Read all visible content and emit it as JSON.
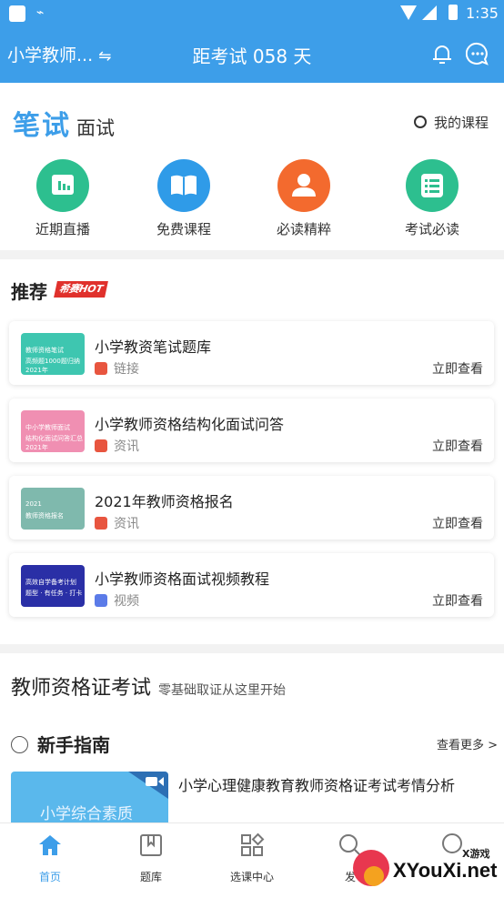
{
  "status_bar": {
    "time": "1:35"
  },
  "header": {
    "exam_name": "小学教师...",
    "countdown": "距考试 058 天"
  },
  "tabs": {
    "active": "笔试",
    "inactive": "面试"
  },
  "my_course": "我的课程",
  "quick_entries": [
    {
      "label": "近期直播",
      "color": "#2dbf8f",
      "icon": "live-stream-icon"
    },
    {
      "label": "免费课程",
      "color": "#2f9be8",
      "icon": "book-icon"
    },
    {
      "label": "必读精粹",
      "color": "#f36a2e",
      "icon": "person-icon"
    },
    {
      "label": "考试必读",
      "color": "#2dbf8f",
      "icon": "list-icon"
    }
  ],
  "recommend": {
    "title": "推荐",
    "hot_badge": "希赛HOT",
    "view_label": "立即查看",
    "items": [
      {
        "title": "小学教资笔试题库",
        "tag": "链接",
        "tag_color": "#e8553f",
        "thumb_color": "#3ec6b0",
        "thumb_line1": "教师资格笔试",
        "thumb_line2": "高频题1000题归纳 2021年"
      },
      {
        "title": "小学教师资格结构化面试问答",
        "tag": "资讯",
        "tag_color": "#e8553f",
        "thumb_color": "#f08fb2",
        "thumb_line1": "中小学教师面试",
        "thumb_line2": "结构化面试问答汇总 2021年"
      },
      {
        "title": "2021年教师资格报名",
        "tag": "资讯",
        "tag_color": "#e8553f",
        "thumb_color": "#7fb9ad",
        "thumb_line1": "2021",
        "thumb_line2": "教师资格报名"
      },
      {
        "title": "小学教师资格面试视频教程",
        "tag": "视频",
        "tag_color": "#5b7be8",
        "thumb_color": "#2a2fa6",
        "thumb_line1": "高效自学备考计划",
        "thumb_line2": "题型 · 有任务 · 打卡"
      }
    ]
  },
  "cert_section": {
    "title": "教师资格证考试",
    "subtitle": "零基础取证从这里开始"
  },
  "guide": {
    "title": "新手指南",
    "more": "查看更多 >",
    "video_text": "小学综合素质",
    "article_title": "小学心理健康教育教师资格证考试考情分析"
  },
  "bottom_nav": [
    {
      "label": "首页",
      "icon": "home-icon",
      "active": true
    },
    {
      "label": "题库",
      "icon": "question-bank-icon",
      "active": false
    },
    {
      "label": "选课中心",
      "icon": "course-center-icon",
      "active": false
    },
    {
      "label": "发",
      "icon": "search-icon",
      "active": false
    },
    {
      "label": "",
      "icon": "profile-icon",
      "active": false
    }
  ],
  "watermark": {
    "top": "X游戏",
    "main": "XYouXi.net"
  },
  "colors": {
    "primary": "#3d9ee9",
    "hot": "#e0312c"
  }
}
